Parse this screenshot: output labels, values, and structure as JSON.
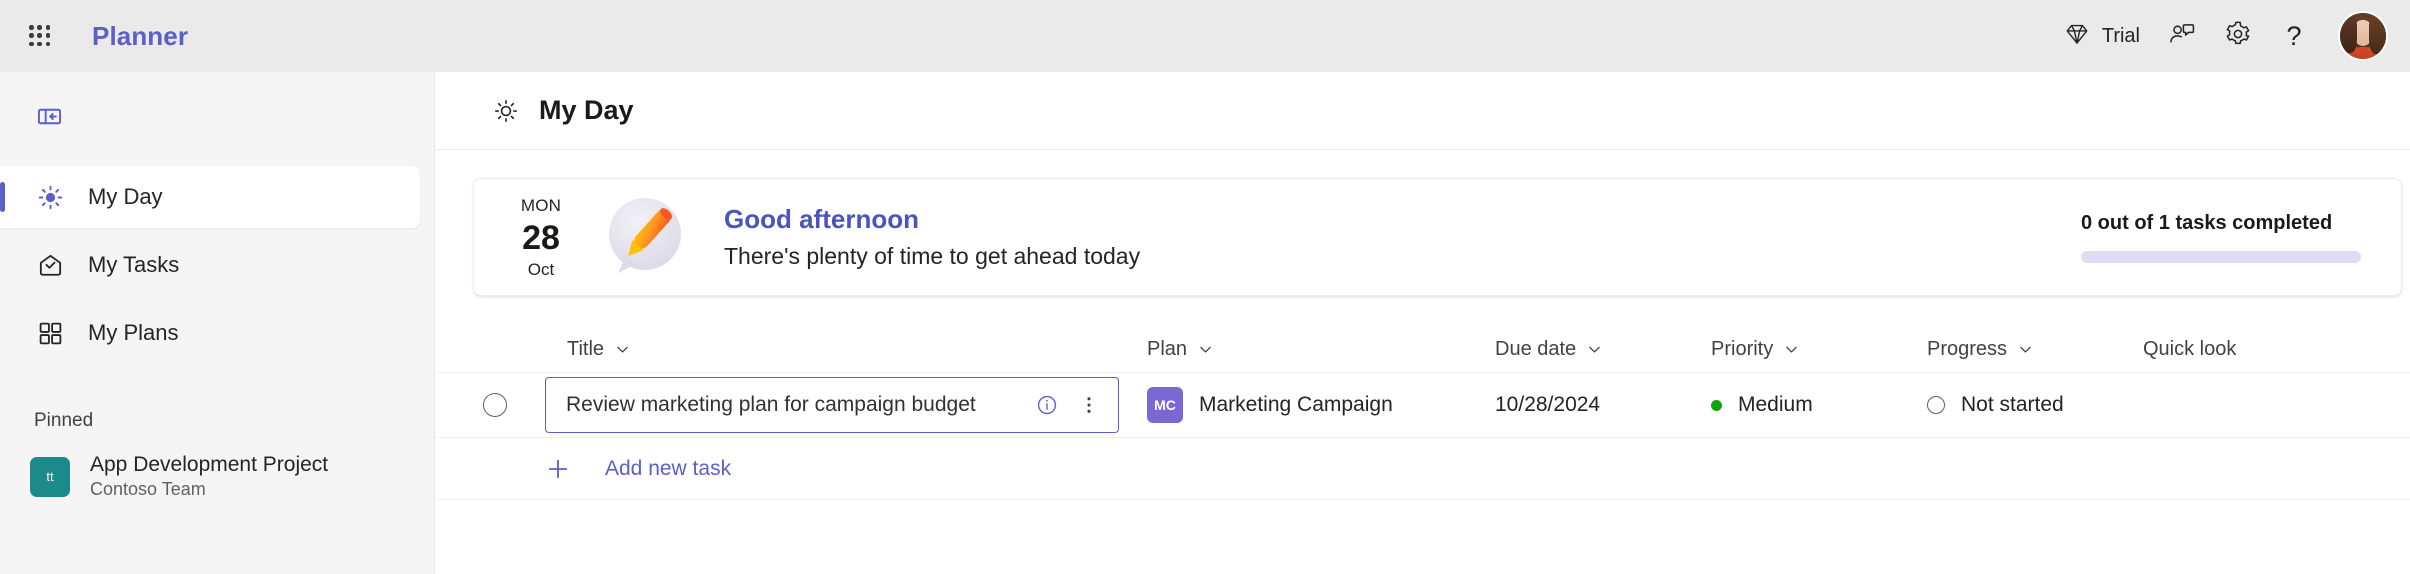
{
  "topbar": {
    "waffle_label": "app-launcher",
    "brand": "Planner",
    "trial_label": "Trial",
    "feedback_label": "feedback-icon",
    "settings_label": "settings-icon",
    "help_label": "?",
    "avatar_label": "account-avatar"
  },
  "sidebar": {
    "collapse_label": "collapse-navigation",
    "items": [
      {
        "label": "My Day",
        "icon": "sun-icon",
        "active": true
      },
      {
        "label": "My Tasks",
        "icon": "tasks-icon",
        "active": false
      },
      {
        "label": "My Plans",
        "icon": "grid-icon",
        "active": false
      }
    ],
    "pinned_header": "Pinned",
    "pinned": [
      {
        "title": "App Development Project",
        "subtitle": "Contoso Team",
        "initials": "tt",
        "color": "#1c8a8a"
      }
    ]
  },
  "page": {
    "title": "My Day",
    "title_icon": "sun-icon"
  },
  "banner": {
    "day_of_week": "MON",
    "day_number": "28",
    "month": "Oct",
    "greeting": "Good afternoon",
    "subtext": "There's plenty of time to get ahead today",
    "progress_label": "0 out of 1 tasks completed",
    "progress_percent": 0,
    "greeting_color": "#4b53bc",
    "progress_track_color": "#dcdcf5"
  },
  "table": {
    "headers": [
      {
        "label": "Title",
        "sortable": true
      },
      {
        "label": "Plan",
        "sortable": true
      },
      {
        "label": "Due date",
        "sortable": true
      },
      {
        "label": "Priority",
        "sortable": true
      },
      {
        "label": "Progress",
        "sortable": true
      },
      {
        "label": "Quick look",
        "sortable": false
      }
    ],
    "rows": [
      {
        "title": "Review marketing plan for campaign budget",
        "plan": "Marketing Campaign",
        "plan_initials": "MC",
        "plan_color": "#7b68d4",
        "due_date": "10/28/2024",
        "priority": "Medium",
        "priority_color": "#13a10e",
        "progress": "Not started",
        "quick_look": "",
        "completed": false
      }
    ],
    "add_new_label": "Add new task",
    "accent_color": "#5b5fc7"
  }
}
